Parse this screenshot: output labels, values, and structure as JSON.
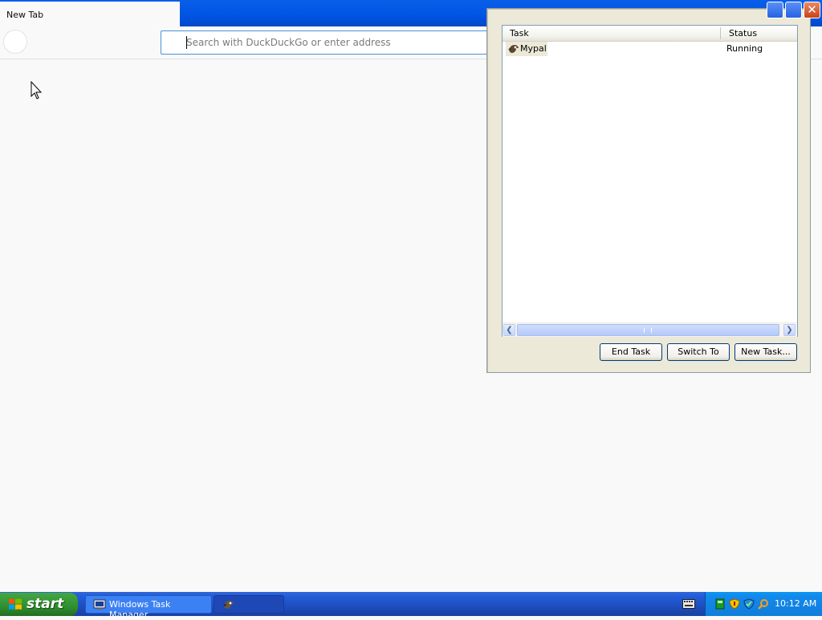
{
  "browser": {
    "tab_title": "New Tab",
    "url_placeholder": "Search with DuckDuckGo or enter address",
    "url_value": ""
  },
  "task_manager": {
    "columns": {
      "task": "Task",
      "status": "Status"
    },
    "rows": [
      {
        "task": "Mypal",
        "status": "Running",
        "icon": "mypal-icon"
      }
    ],
    "buttons": {
      "end_task": "End Task",
      "switch_to": "Switch To",
      "new_task": "New Task..."
    }
  },
  "taskbar": {
    "start_label": "start",
    "buttons": [
      {
        "label": "Windows Task Manager",
        "icon": "task-manager-icon"
      },
      {
        "label": "",
        "icon": "mypal-icon"
      }
    ],
    "clock": "10:12 AM"
  },
  "colors": {
    "xp_blue": "#0054e3",
    "start_green": "#3c9a3c",
    "window_face": "#ece9d8",
    "close_red": "#d8542a"
  }
}
